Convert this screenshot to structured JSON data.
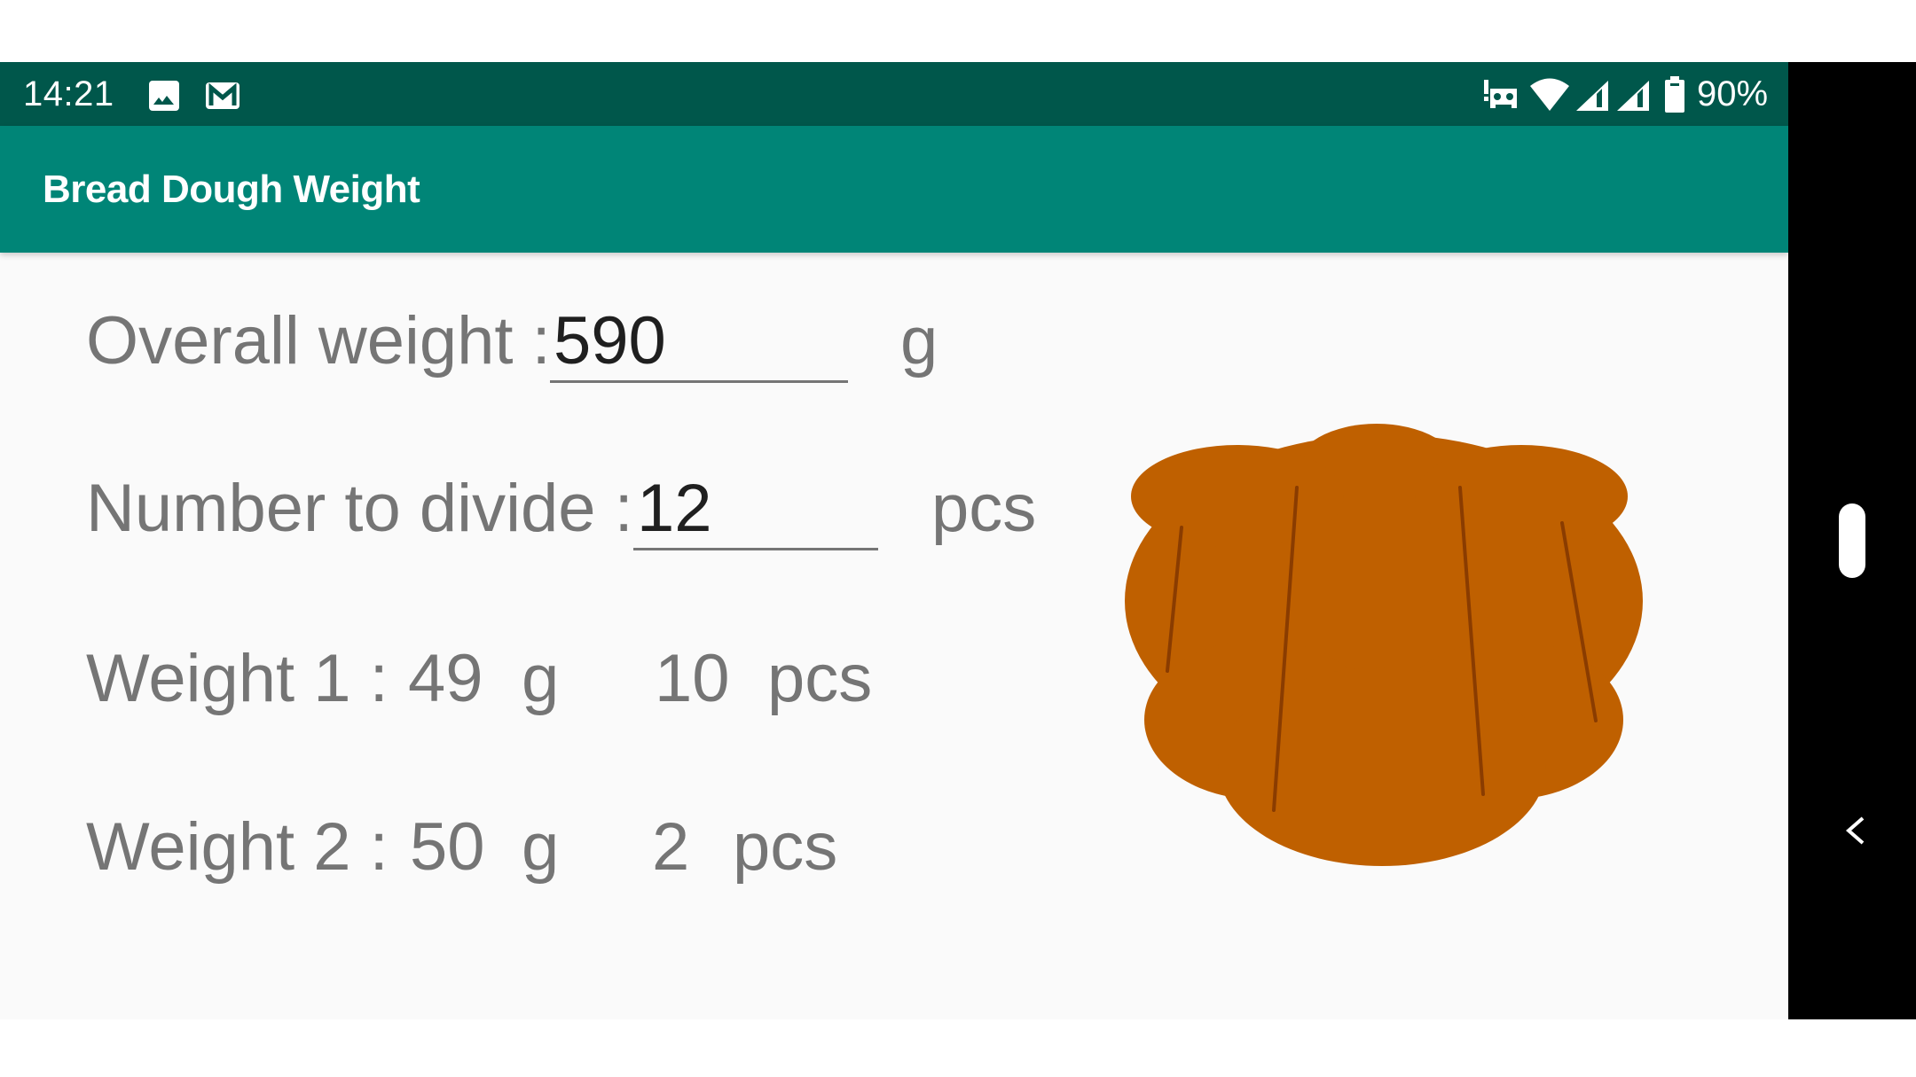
{
  "status_bar": {
    "time": "14:21",
    "left_icons": [
      "image-icon",
      "gmail-icon"
    ],
    "right_icons": [
      "car-mode-alert-icon",
      "wifi-icon",
      "signal-icon",
      "signal-icon",
      "battery-icon"
    ],
    "battery_percent": "90%"
  },
  "app_bar": {
    "title": "Bread Dough Weight"
  },
  "form": {
    "overall_weight": {
      "label": "Overall weight :",
      "value": "590",
      "unit": "g"
    },
    "number_to_divide": {
      "label": "Number to divide :",
      "value": "12",
      "unit": "pcs"
    }
  },
  "results": [
    {
      "label": "Weight 1 :",
      "weight": "49",
      "weight_unit": "g",
      "count": "10",
      "count_unit": "pcs"
    },
    {
      "label": "Weight 2 :",
      "weight": "50",
      "weight_unit": "g",
      "count": "2",
      "count_unit": "pcs"
    }
  ],
  "colors": {
    "status_bar": "#00574b",
    "app_bar": "#008577",
    "bread": "#bf6000",
    "bread_score": "#8a3c00",
    "label_text": "#757575",
    "input_text": "#1f1f1f"
  }
}
